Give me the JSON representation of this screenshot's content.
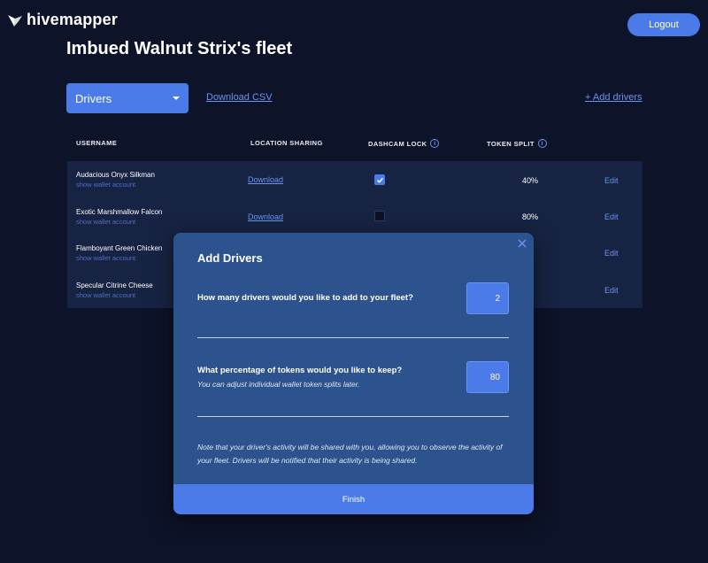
{
  "brand": {
    "logo_icon": "hivemapper-wings-icon",
    "name": "hivemapper"
  },
  "header": {
    "logout_label": "Logout"
  },
  "page": {
    "title": "Imbued Walnut Strix's fleet"
  },
  "toolbar": {
    "select_value": "Drivers",
    "download_csv_label": "Download CSV",
    "add_drivers_label": "+ Add drivers"
  },
  "table": {
    "columns": {
      "username": "USERNAME",
      "location_sharing": "LOCATION SHARING",
      "dashcam_lock": "DASHCAM LOCK",
      "token_split": "TOKEN SPLIT"
    },
    "rows": [
      {
        "username": "Audacious Onyx Silkman",
        "wallet": "show wallet account",
        "location": "Download",
        "dashcam_lock": true,
        "token_split": "40%",
        "edit": "Edit"
      },
      {
        "username": "Exotic Marshmallow Falcon",
        "wallet": "show wallet account",
        "location": "Download",
        "dashcam_lock": false,
        "token_split": "80%",
        "edit": "Edit"
      },
      {
        "username": "Flamboyant Green Chicken",
        "wallet": "show wallet account",
        "location": "",
        "dashcam_lock": null,
        "token_split": "",
        "edit": "Edit"
      },
      {
        "username": "Specular Citrine Cheese",
        "wallet": "show wallet account",
        "location": "",
        "dashcam_lock": null,
        "token_split": "",
        "edit": "Edit"
      }
    ]
  },
  "modal": {
    "title": "Add Drivers",
    "q1_label": "How many drivers would you like to add to your fleet?",
    "q1_value": "2",
    "q2_label": "What percentage of tokens would you like to keep?",
    "q2_sub": "You can adjust individual wallet token splits later.",
    "q2_value": "80",
    "note": "Note that your driver's activity will be shared with you, allowing you to observe the activity of your fleet. Drivers will be notified that their activity is being shared.",
    "finish_label": "Finish"
  },
  "colors": {
    "background": "#0d1328",
    "panel": "#172343",
    "accent": "#4a7be8",
    "link": "#6b93f0",
    "modal": "#2d538f"
  }
}
